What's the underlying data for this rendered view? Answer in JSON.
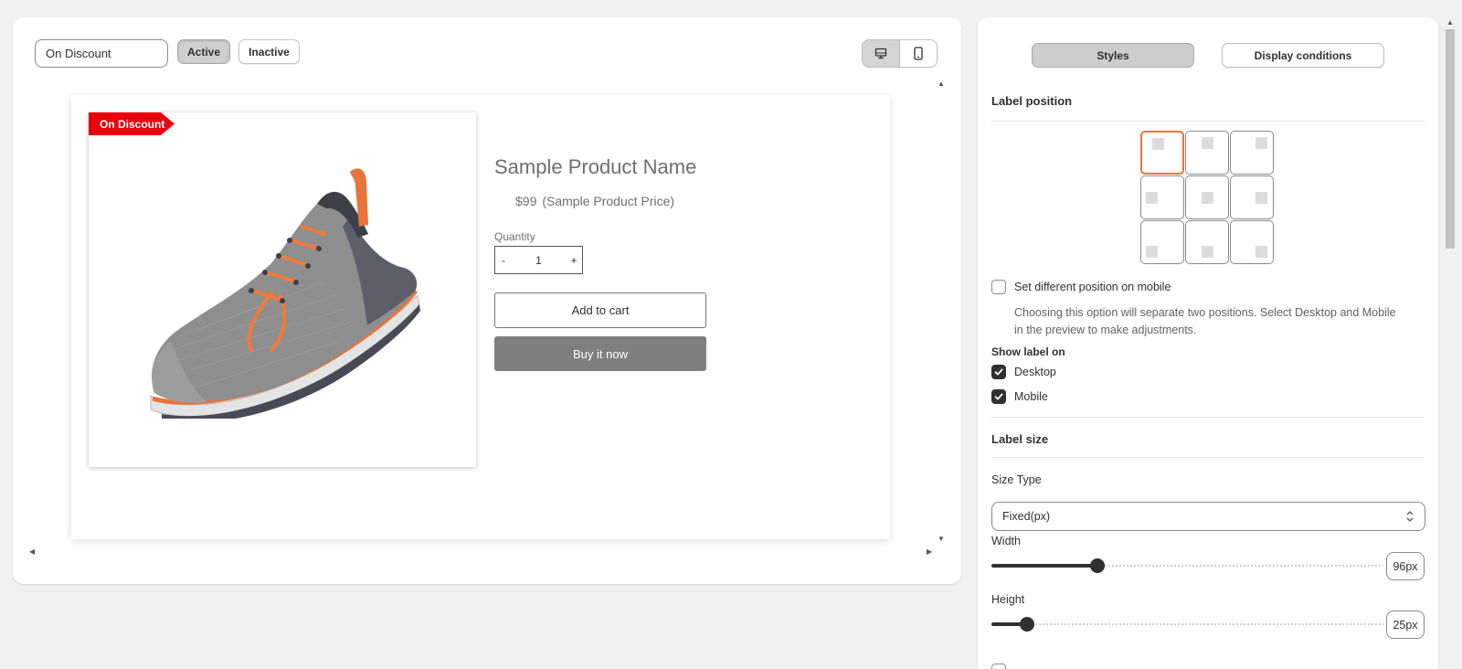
{
  "preview": {
    "label_name_value": "On Discount",
    "status": {
      "active_label": "Active",
      "inactive_label": "Inactive",
      "selected": "Active"
    },
    "device": {
      "selected": "desktop",
      "options": [
        "desktop-icon",
        "mobile-icon"
      ]
    },
    "badge_text": "On Discount",
    "badge_color": "#e8000f",
    "product": {
      "name": "Sample Product Name",
      "price": "$99",
      "price_note": "(Sample Product Price)",
      "quantity_label": "Quantity",
      "qty_minus": "-",
      "qty_value": "1",
      "qty_plus": "+",
      "add_to_cart": "Add to cart",
      "buy_now": "Buy it now"
    }
  },
  "settings": {
    "tabs": [
      {
        "label": "Styles",
        "selected": true
      },
      {
        "label": "Display conditions",
        "selected": false
      }
    ],
    "label_position": {
      "title": "Label position",
      "selected_cell": "top-left",
      "mobile_option_label": "Set different position on mobile",
      "mobile_option_checked": false,
      "helper": "Choosing this option will separate two positions. Select Desktop and Mobile in the preview to make adjustments.",
      "show_label_on_title": "Show label on",
      "desktop_label": "Desktop",
      "desktop_checked": true,
      "mobile_label": "Mobile",
      "mobile_checked": true
    },
    "label_size": {
      "title": "Label size",
      "size_type_label": "Size Type",
      "size_type_value": "Fixed(px)",
      "width_label": "Width",
      "width_value": "96px",
      "width_fraction": 0.27,
      "height_label": "Height",
      "height_value": "25px",
      "height_fraction": 0.09
    },
    "accent_color": "#e8743b"
  }
}
